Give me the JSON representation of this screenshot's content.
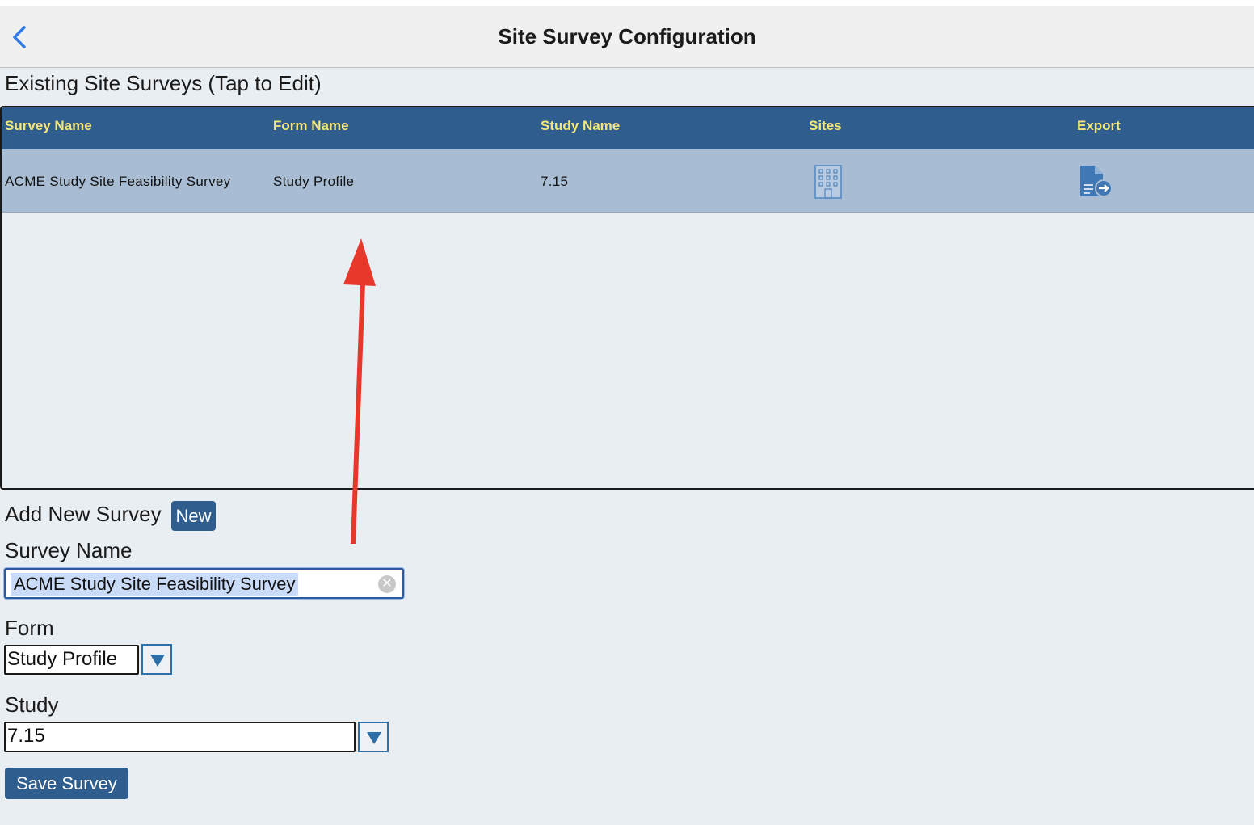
{
  "nav": {
    "title": "Site Survey Configuration",
    "back_icon": "chevron-left-icon",
    "accent": "#2f7ae5"
  },
  "existing": {
    "heading": "Existing Site Surveys (Tap to Edit)",
    "columns": [
      "Survey Name",
      "Form Name",
      "Study Name",
      "Sites",
      "Export"
    ],
    "rows": [
      {
        "survey_name": "ACME Study Site Feasibility Survey",
        "form_name": "Study Profile",
        "study_name": "7.15",
        "sites_icon": "building-icon",
        "export_icon": "document-export-icon"
      }
    ],
    "header_color": "#2f5d8e",
    "header_text_color": "#f4e77a",
    "row_color": "#a8bdd3"
  },
  "add_new": {
    "heading": "Add New Survey",
    "new_button": "New"
  },
  "form": {
    "survey_name_label": "Survey Name",
    "survey_name_value": "ACME Study Site Feasibility Survey",
    "form_label": "Form",
    "form_value": "Study Profile",
    "study_label": "Study",
    "study_value": "7.15",
    "save_button": "Save Survey"
  },
  "annotation": {
    "type": "arrow",
    "color": "#e8382b",
    "direction": "up"
  }
}
